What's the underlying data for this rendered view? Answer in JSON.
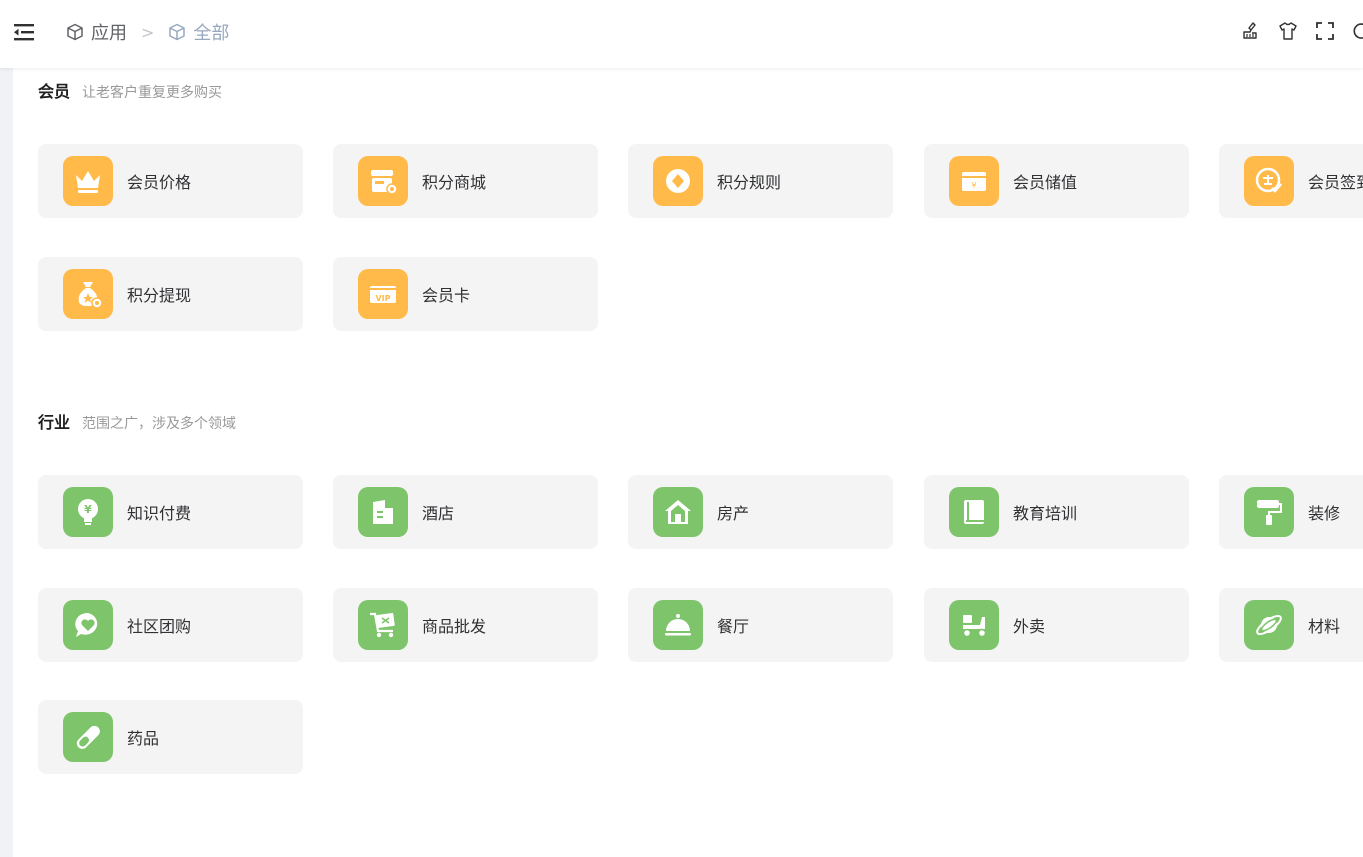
{
  "header": {
    "breadcrumb": [
      {
        "label": "应用",
        "icon": "cube-icon"
      },
      {
        "label": "全部",
        "icon": "cube-icon"
      }
    ],
    "separator": ">",
    "tools": [
      "brush-icon",
      "tshirt-icon",
      "fullscreen-icon",
      "refresh-icon"
    ]
  },
  "colors": {
    "member_icon_bg": "#ffba4a",
    "industry_icon_bg": "#7dc46b",
    "card_bg": "#f4f4f4"
  },
  "sections": {
    "member": {
      "title": "会员",
      "subtitle": "让老客户重复更多购买",
      "items": [
        {
          "label": "会员价格",
          "icon": "crown-icon"
        },
        {
          "label": "积分商城",
          "icon": "store-icon"
        },
        {
          "label": "积分规则",
          "icon": "diamond-coin-icon"
        },
        {
          "label": "会员储值",
          "icon": "wallet-icon"
        },
        {
          "label": "会员签到",
          "icon": "sign-in-icon"
        },
        {
          "label": "积分提现",
          "icon": "money-bag-icon"
        },
        {
          "label": "会员卡",
          "icon": "vip-card-icon"
        }
      ]
    },
    "industry": {
      "title": "行业",
      "subtitle": "范围之广，涉及多个领域",
      "items": [
        {
          "label": "知识付费",
          "icon": "lightbulb-yen-icon"
        },
        {
          "label": "酒店",
          "icon": "hotel-icon"
        },
        {
          "label": "房产",
          "icon": "house-icon"
        },
        {
          "label": "教育培训",
          "icon": "book-icon"
        },
        {
          "label": "装修",
          "icon": "paint-roller-icon"
        },
        {
          "label": "社区团购",
          "icon": "chat-heart-icon"
        },
        {
          "label": "商品批发",
          "icon": "cart-icon"
        },
        {
          "label": "餐厅",
          "icon": "food-cloche-icon"
        },
        {
          "label": "外卖",
          "icon": "scooter-icon"
        },
        {
          "label": "材料",
          "icon": "planet-icon"
        },
        {
          "label": "药品",
          "icon": "pill-icon"
        }
      ]
    }
  }
}
